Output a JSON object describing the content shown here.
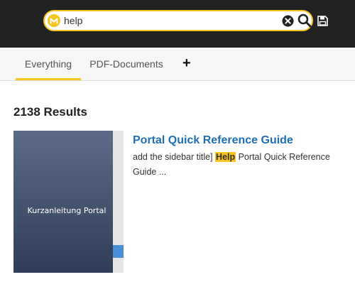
{
  "search": {
    "value": "help",
    "placeholder": ""
  },
  "tabs": [
    {
      "label": "Everything",
      "active": true
    },
    {
      "label": "PDF-Documents",
      "active": false
    }
  ],
  "add_tab_label": "+",
  "results": {
    "count_text": "2138 Results",
    "items": [
      {
        "title": "Portal Quick Reference Guide",
        "thumbnail_label": "Kurzanleitung Portal",
        "snippet_before": "add the sidebar title] ",
        "snippet_highlight": "Help",
        "snippet_after": " Portal Quick Reference Guide ..."
      }
    ]
  },
  "icons": {
    "logo": "brand-logo-icon",
    "clear": "clear-icon",
    "search": "search-icon",
    "save": "save-icon"
  },
  "colors": {
    "accent": "#f6c520",
    "topbar": "#222222",
    "link": "#1f6fb4",
    "scroll_thumb": "#4a90d9"
  }
}
